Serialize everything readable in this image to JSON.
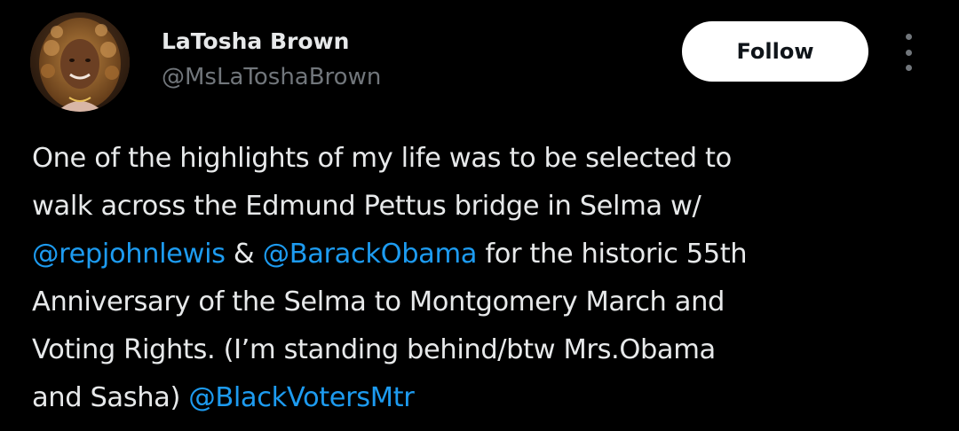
{
  "author": {
    "name": "LaTosha Brown",
    "handle": "@MsLaToshaBrown",
    "avatar": "profile-photo"
  },
  "actions": {
    "follow_label": "Follow",
    "more_icon": "more-vertical-icon"
  },
  "tweet": {
    "segments": [
      {
        "text": "One of the highlights of my life was to be selected to",
        "type": "text"
      },
      {
        "text": "walk across the Edmund Pettus bridge in Selma w/",
        "type": "text"
      },
      {
        "text": "@repjohnlewis",
        "type": "mention"
      },
      {
        "text": " & ",
        "type": "text"
      },
      {
        "text": "@BarackObama",
        "type": "mention"
      },
      {
        "text": " for the historic 55th",
        "type": "text"
      },
      {
        "text": "Anniversary of the Selma to Montgomery March and",
        "type": "text"
      },
      {
        "text": "Voting Rights. (I’m standing behind/btw Mrs.Obama",
        "type": "text"
      },
      {
        "text": "and Sasha) ",
        "type": "text"
      },
      {
        "text": "@BlackVotersMtr",
        "type": "mention"
      }
    ]
  },
  "colors": {
    "background": "#000000",
    "primary_text": "#e7e9ea",
    "secondary_text": "#71767b",
    "link": "#1d9bf0",
    "button_bg": "#ffffff",
    "button_text": "#0f1419"
  }
}
